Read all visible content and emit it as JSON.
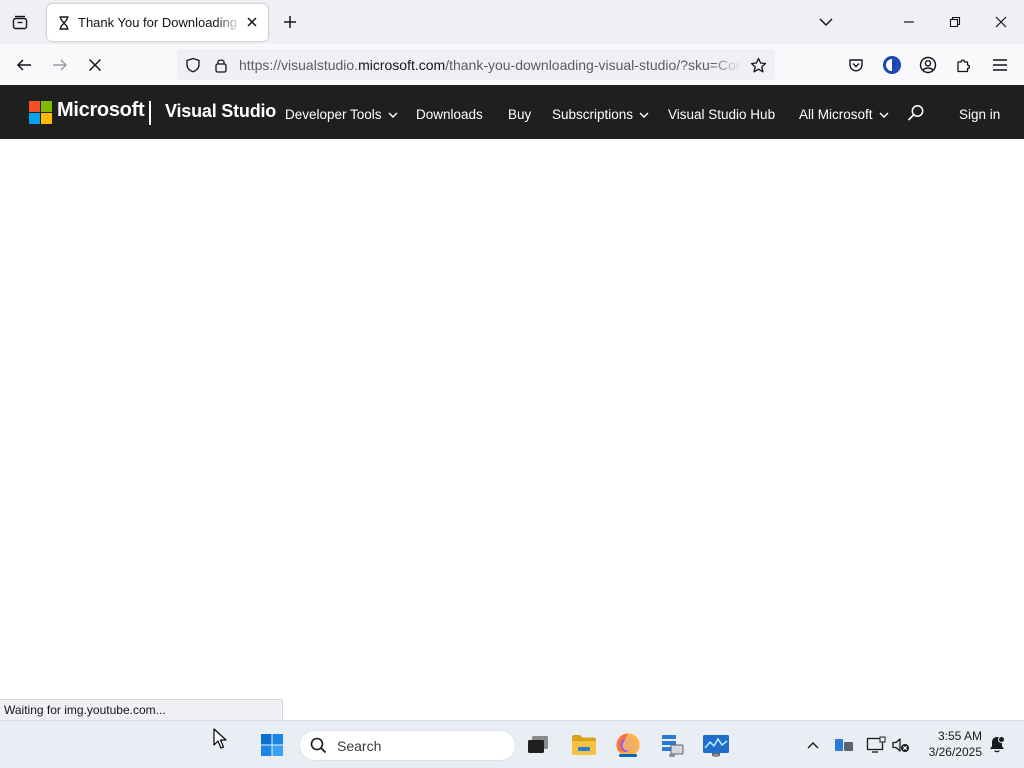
{
  "browser": {
    "tab": {
      "title": "Thank You for Downloading Visual Studio"
    },
    "url": {
      "prefix": "https://visualstudio.",
      "domain": "microsoft.com",
      "path": "/thank-you-downloading-visual-studio/?sku=Community"
    },
    "status_text": "Waiting for img.youtube.com..."
  },
  "site_header": {
    "brand": "Microsoft",
    "product": "Visual Studio",
    "nav": [
      {
        "label": "Developer Tools",
        "dropdown": true
      },
      {
        "label": "Downloads",
        "dropdown": false
      },
      {
        "label": "Buy",
        "dropdown": false
      },
      {
        "label": "Subscriptions",
        "dropdown": true
      },
      {
        "label": "Visual Studio Hub",
        "dropdown": false
      },
      {
        "label": "All Microsoft",
        "dropdown": true
      }
    ],
    "sign_in": "Sign in"
  },
  "taskbar": {
    "search_label": "Search",
    "time": "3:55 AM",
    "date": "3/26/2025"
  },
  "colors": {
    "header_bg": "#1f1f1f",
    "ms_red": "#f25022",
    "ms_green": "#7fba00",
    "ms_blue": "#00a4ef",
    "ms_yellow": "#ffb900",
    "taskbar_bg": "#e9eef5",
    "active_indicator": "#0067c0"
  },
  "icons": {
    "tab_list": "tab-list-icon",
    "tab_loading": "hourglass-icon",
    "back": "arrow-left-icon",
    "forward": "arrow-right-icon",
    "stop": "close-icon",
    "tracking": "shield-icon",
    "secure": "lock-icon",
    "bookmark": "star-icon",
    "pocket": "pocket-icon",
    "account": "account-icon",
    "extensions": "puzzle-icon",
    "menu": "hamburger-icon"
  }
}
